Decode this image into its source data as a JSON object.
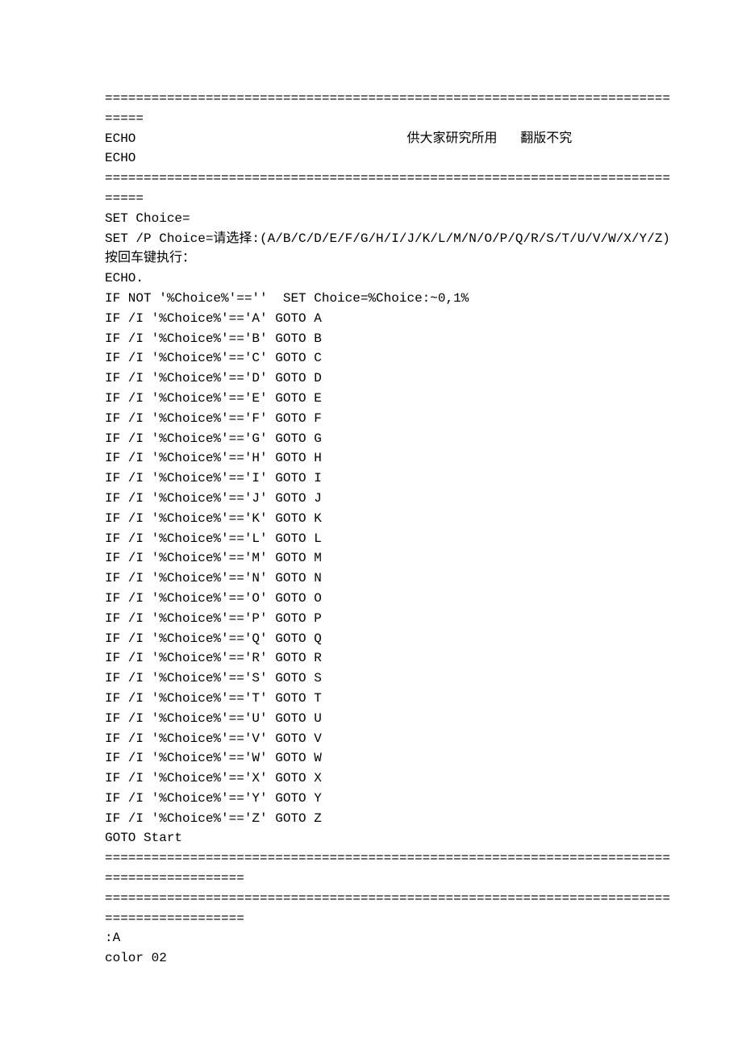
{
  "lines": [
    "==============================================================================",
    "ECHO                                   供大家研究所用   翻版不究",
    "ECHO",
    "==============================================================================",
    "SET Choice=",
    "SET /P Choice=请选择:(A/B/C/D/E/F/G/H/I/J/K/L/M/N/O/P/Q/R/S/T/U/V/W/X/Y/Z)按回车键执行：",
    "ECHO.",
    "IF NOT '%Choice%'==''  SET Choice=%Choice:~0,1%",
    "IF /I '%Choice%'=='A' GOTO A",
    "IF /I '%Choice%'=='B' GOTO B",
    "IF /I '%Choice%'=='C' GOTO C",
    "IF /I '%Choice%'=='D' GOTO D",
    "IF /I '%Choice%'=='E' GOTO E",
    "IF /I '%Choice%'=='F' GOTO F",
    "IF /I '%Choice%'=='G' GOTO G",
    "IF /I '%Choice%'=='H' GOTO H",
    "IF /I '%Choice%'=='I' GOTO I",
    "IF /I '%Choice%'=='J' GOTO J",
    "IF /I '%Choice%'=='K' GOTO K",
    "IF /I '%Choice%'=='L' GOTO L",
    "IF /I '%Choice%'=='M' GOTO M",
    "IF /I '%Choice%'=='N' GOTO N",
    "IF /I '%Choice%'=='O' GOTO O",
    "IF /I '%Choice%'=='P' GOTO P",
    "IF /I '%Choice%'=='Q' GOTO Q",
    "IF /I '%Choice%'=='R' GOTO R",
    "IF /I '%Choice%'=='S' GOTO S",
    "IF /I '%Choice%'=='T' GOTO T",
    "IF /I '%Choice%'=='U' GOTO U",
    "IF /I '%Choice%'=='V' GOTO V",
    "IF /I '%Choice%'=='W' GOTO W",
    "IF /I '%Choice%'=='X' GOTO X",
    "IF /I '%Choice%'=='Y' GOTO Y",
    "IF /I '%Choice%'=='Z' GOTO Z",
    "GOTO Start",
    "===========================================================================================",
    "===========================================================================================",
    ":A",
    "color 02"
  ]
}
